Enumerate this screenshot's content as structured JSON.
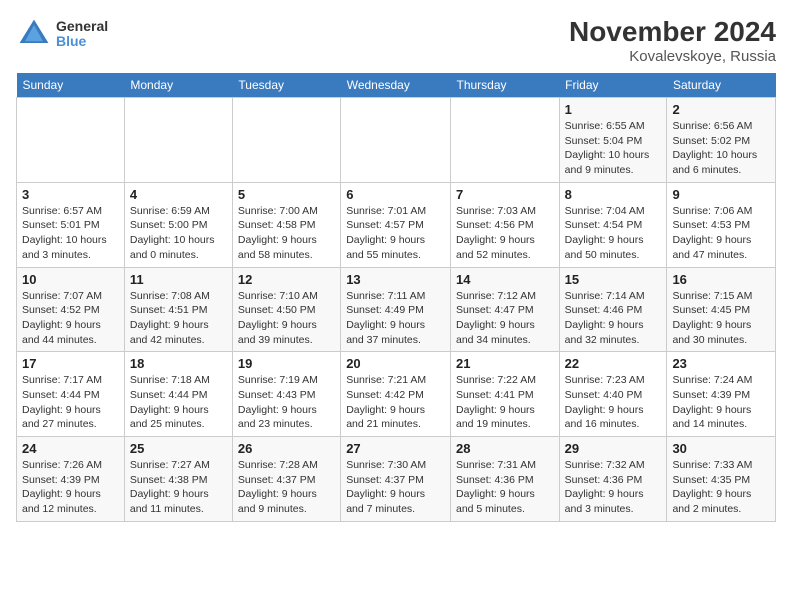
{
  "header": {
    "logo_line1": "General",
    "logo_line2": "Blue",
    "month_year": "November 2024",
    "location": "Kovalevskoye, Russia"
  },
  "weekdays": [
    "Sunday",
    "Monday",
    "Tuesday",
    "Wednesday",
    "Thursday",
    "Friday",
    "Saturday"
  ],
  "weeks": [
    [
      {
        "day": "",
        "info": ""
      },
      {
        "day": "",
        "info": ""
      },
      {
        "day": "",
        "info": ""
      },
      {
        "day": "",
        "info": ""
      },
      {
        "day": "",
        "info": ""
      },
      {
        "day": "1",
        "info": "Sunrise: 6:55 AM\nSunset: 5:04 PM\nDaylight: 10 hours and 9 minutes."
      },
      {
        "day": "2",
        "info": "Sunrise: 6:56 AM\nSunset: 5:02 PM\nDaylight: 10 hours and 6 minutes."
      }
    ],
    [
      {
        "day": "3",
        "info": "Sunrise: 6:57 AM\nSunset: 5:01 PM\nDaylight: 10 hours and 3 minutes."
      },
      {
        "day": "4",
        "info": "Sunrise: 6:59 AM\nSunset: 5:00 PM\nDaylight: 10 hours and 0 minutes."
      },
      {
        "day": "5",
        "info": "Sunrise: 7:00 AM\nSunset: 4:58 PM\nDaylight: 9 hours and 58 minutes."
      },
      {
        "day": "6",
        "info": "Sunrise: 7:01 AM\nSunset: 4:57 PM\nDaylight: 9 hours and 55 minutes."
      },
      {
        "day": "7",
        "info": "Sunrise: 7:03 AM\nSunset: 4:56 PM\nDaylight: 9 hours and 52 minutes."
      },
      {
        "day": "8",
        "info": "Sunrise: 7:04 AM\nSunset: 4:54 PM\nDaylight: 9 hours and 50 minutes."
      },
      {
        "day": "9",
        "info": "Sunrise: 7:06 AM\nSunset: 4:53 PM\nDaylight: 9 hours and 47 minutes."
      }
    ],
    [
      {
        "day": "10",
        "info": "Sunrise: 7:07 AM\nSunset: 4:52 PM\nDaylight: 9 hours and 44 minutes."
      },
      {
        "day": "11",
        "info": "Sunrise: 7:08 AM\nSunset: 4:51 PM\nDaylight: 9 hours and 42 minutes."
      },
      {
        "day": "12",
        "info": "Sunrise: 7:10 AM\nSunset: 4:50 PM\nDaylight: 9 hours and 39 minutes."
      },
      {
        "day": "13",
        "info": "Sunrise: 7:11 AM\nSunset: 4:49 PM\nDaylight: 9 hours and 37 minutes."
      },
      {
        "day": "14",
        "info": "Sunrise: 7:12 AM\nSunset: 4:47 PM\nDaylight: 9 hours and 34 minutes."
      },
      {
        "day": "15",
        "info": "Sunrise: 7:14 AM\nSunset: 4:46 PM\nDaylight: 9 hours and 32 minutes."
      },
      {
        "day": "16",
        "info": "Sunrise: 7:15 AM\nSunset: 4:45 PM\nDaylight: 9 hours and 30 minutes."
      }
    ],
    [
      {
        "day": "17",
        "info": "Sunrise: 7:17 AM\nSunset: 4:44 PM\nDaylight: 9 hours and 27 minutes."
      },
      {
        "day": "18",
        "info": "Sunrise: 7:18 AM\nSunset: 4:44 PM\nDaylight: 9 hours and 25 minutes."
      },
      {
        "day": "19",
        "info": "Sunrise: 7:19 AM\nSunset: 4:43 PM\nDaylight: 9 hours and 23 minutes."
      },
      {
        "day": "20",
        "info": "Sunrise: 7:21 AM\nSunset: 4:42 PM\nDaylight: 9 hours and 21 minutes."
      },
      {
        "day": "21",
        "info": "Sunrise: 7:22 AM\nSunset: 4:41 PM\nDaylight: 9 hours and 19 minutes."
      },
      {
        "day": "22",
        "info": "Sunrise: 7:23 AM\nSunset: 4:40 PM\nDaylight: 9 hours and 16 minutes."
      },
      {
        "day": "23",
        "info": "Sunrise: 7:24 AM\nSunset: 4:39 PM\nDaylight: 9 hours and 14 minutes."
      }
    ],
    [
      {
        "day": "24",
        "info": "Sunrise: 7:26 AM\nSunset: 4:39 PM\nDaylight: 9 hours and 12 minutes."
      },
      {
        "day": "25",
        "info": "Sunrise: 7:27 AM\nSunset: 4:38 PM\nDaylight: 9 hours and 11 minutes."
      },
      {
        "day": "26",
        "info": "Sunrise: 7:28 AM\nSunset: 4:37 PM\nDaylight: 9 hours and 9 minutes."
      },
      {
        "day": "27",
        "info": "Sunrise: 7:30 AM\nSunset: 4:37 PM\nDaylight: 9 hours and 7 minutes."
      },
      {
        "day": "28",
        "info": "Sunrise: 7:31 AM\nSunset: 4:36 PM\nDaylight: 9 hours and 5 minutes."
      },
      {
        "day": "29",
        "info": "Sunrise: 7:32 AM\nSunset: 4:36 PM\nDaylight: 9 hours and 3 minutes."
      },
      {
        "day": "30",
        "info": "Sunrise: 7:33 AM\nSunset: 4:35 PM\nDaylight: 9 hours and 2 minutes."
      }
    ]
  ]
}
